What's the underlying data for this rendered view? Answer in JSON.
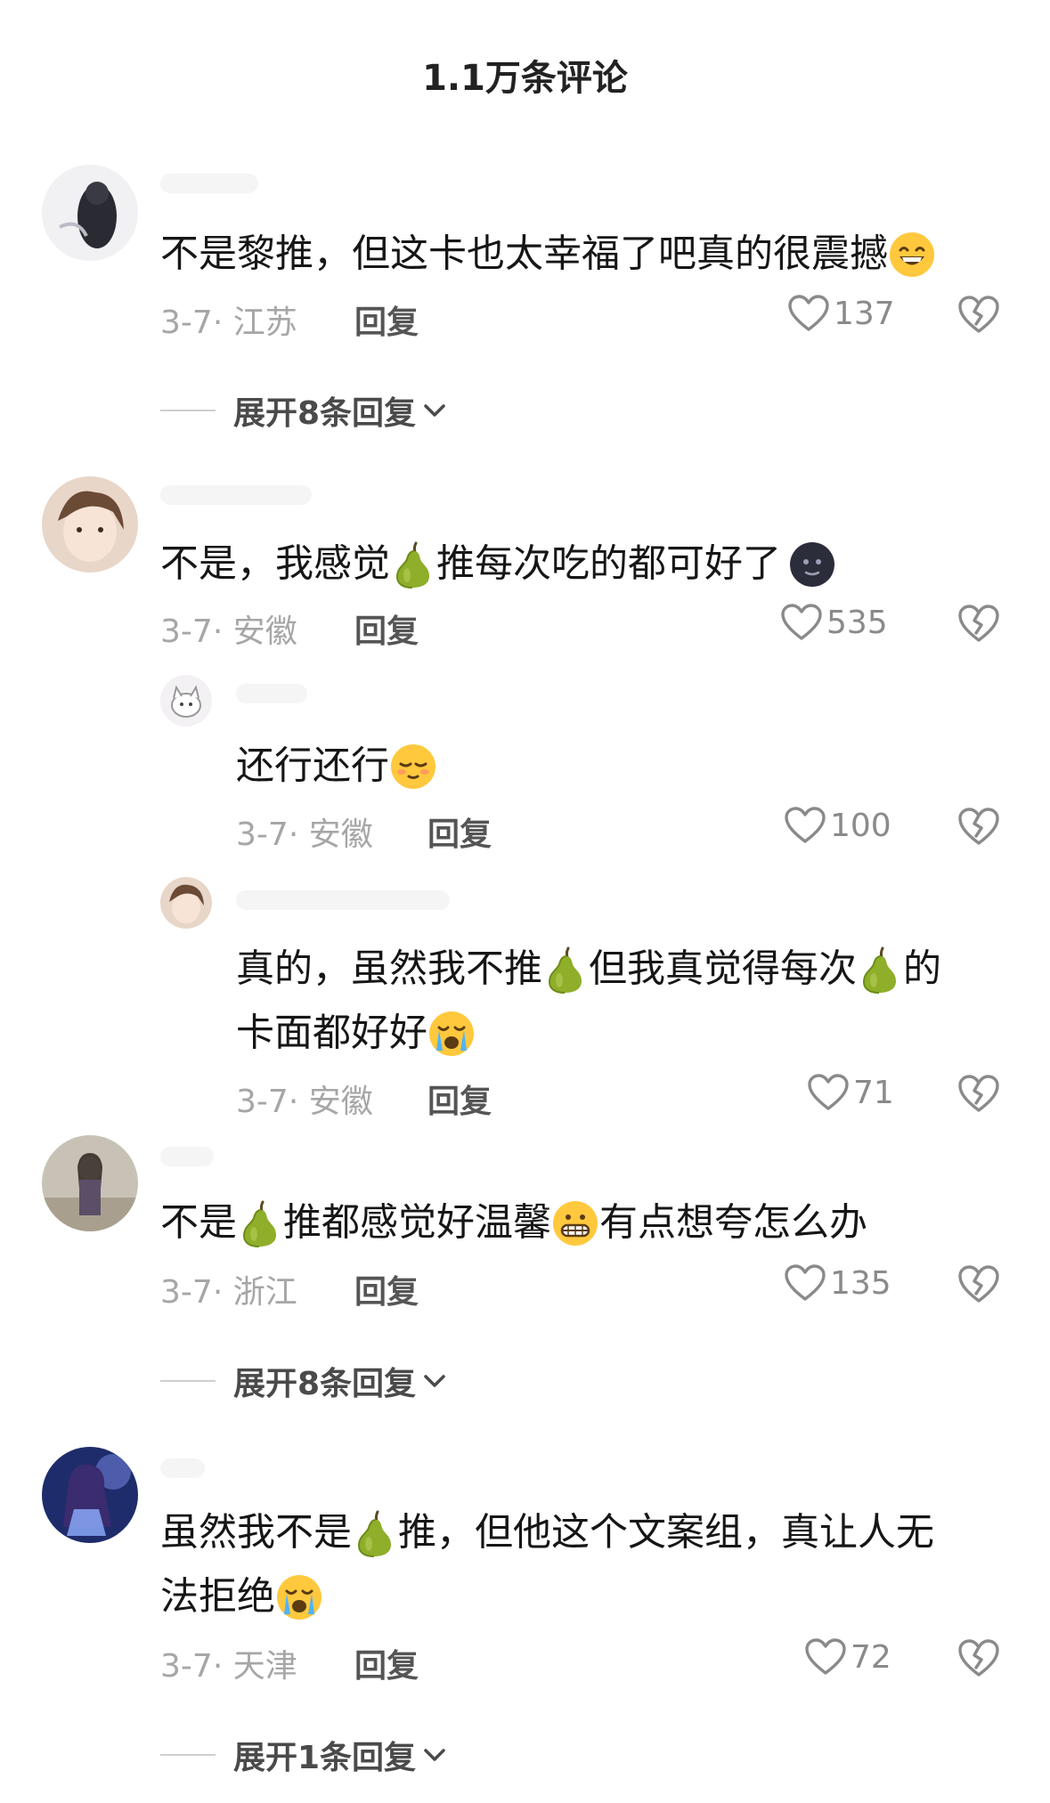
{
  "header": {
    "title": "1.1万条评论"
  },
  "comments": [
    {
      "text": [
        "不是黎推，但这卡也太幸福了吧真的很震撼"
      ],
      "date": "3-7",
      "location": "江苏",
      "reply_label": "回复",
      "likes": "137",
      "expand_label": "展开8条回复"
    },
    {
      "text": [
        "不是，我感觉",
        "推每次吃的都可好了"
      ],
      "date": "3-7",
      "location": "安徽",
      "reply_label": "回复",
      "likes": "535"
    },
    {
      "text": [
        "还行还行"
      ],
      "date": "3-7",
      "location": "安徽",
      "reply_label": "回复",
      "likes": "100"
    },
    {
      "text": [
        "真的，虽然我不推",
        "但我真觉得每次",
        "的",
        "卡面都好好"
      ],
      "date": "3-7",
      "location": "安徽",
      "reply_label": "回复",
      "likes": "71"
    },
    {
      "text": [
        "不是",
        "推都感觉好温馨",
        "有点想夸怎么办"
      ],
      "date": "3-7",
      "location": "浙江",
      "reply_label": "回复",
      "likes": "135",
      "expand_label": "展开8条回复"
    },
    {
      "text": [
        "虽然我不是",
        "推，但他这个文案组，真让人无",
        "法拒绝"
      ],
      "date": "3-7",
      "location": "天津",
      "reply_label": "回复",
      "likes": "72",
      "expand_label": "展开1条回复"
    }
  ],
  "icons": {
    "like": "heart-outline-icon",
    "dislike": "broken-heart-icon",
    "expand": "chevron-down-icon",
    "pear": "pear-emoji",
    "colors": {
      "pear": "#8fae2a",
      "emoji_yellow": "#ffc83d",
      "meta": "#a6a6a6"
    }
  }
}
